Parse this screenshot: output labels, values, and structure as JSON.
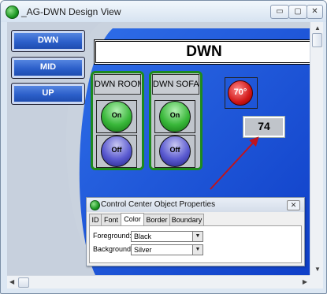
{
  "window": {
    "title": "_AG-DWN Design View",
    "controls": {
      "minimize": "▭",
      "maximize": "▢",
      "close": "✕"
    }
  },
  "nav_buttons": [
    {
      "label": "DWN"
    },
    {
      "label": "MID"
    },
    {
      "label": "UP"
    }
  ],
  "header": {
    "label": "DWN"
  },
  "rooms": [
    {
      "label": "DWN ROOM",
      "on_label": "On",
      "off_label": "Off"
    },
    {
      "label": "DWN SOFA",
      "on_label": "On",
      "off_label": "Off"
    }
  ],
  "temperature": {
    "label": "70°"
  },
  "value_display": {
    "label": "74"
  },
  "properties_dialog": {
    "title": "Control Center Object Properties",
    "tabs": [
      "ID",
      "Font",
      "Color",
      "Border",
      "Boundary"
    ],
    "active_tab": "Color",
    "fields": [
      {
        "label": "Foreground:",
        "value": "Black"
      },
      {
        "label": "Background:",
        "value": "Silver"
      }
    ]
  },
  "colors": {
    "accent_blue": "#1a4fd6",
    "room_border": "#1d8a1d",
    "arrow": "#c0141c"
  },
  "icons": {
    "app": "green-ball-icon",
    "dropdown": "chevron-down-icon"
  }
}
